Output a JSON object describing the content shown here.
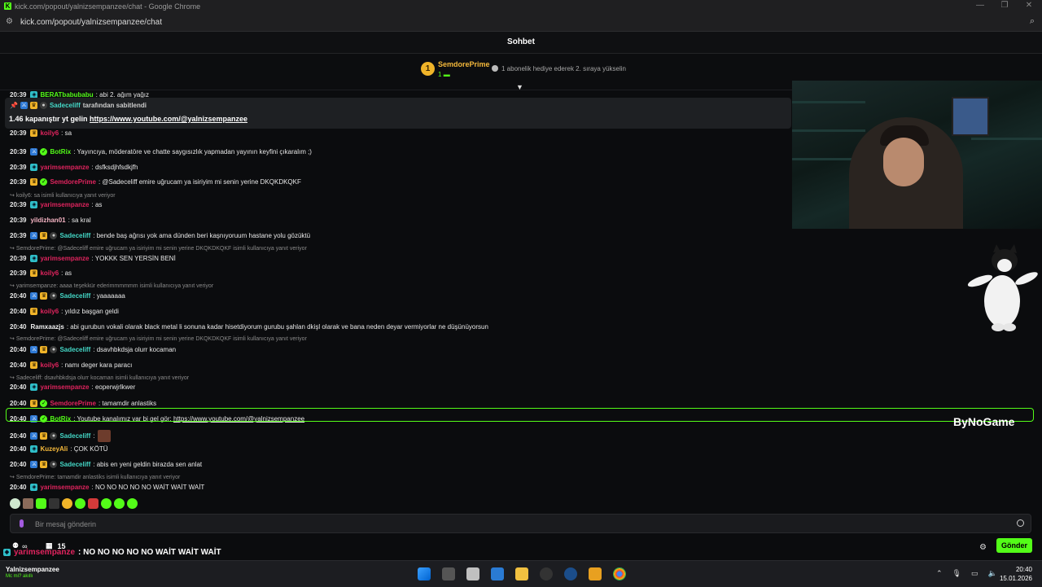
{
  "window": {
    "title": "kick.com/popout/yalnizsempanzee/chat - Google Chrome",
    "url": "kick.com/popout/yalnizsempanzee/chat"
  },
  "chat": {
    "header": "Sohbet",
    "leader": {
      "rank": "1",
      "name": "SemdorePrime",
      "count": "1",
      "hint": "1 abonelik hediye ederek 2. sıraya yükselin"
    },
    "pinned": {
      "by_user": "Sadeceliff",
      "by_suffix": "tarafından sabitlendi",
      "text_prefix": "1.46 kapanıştır yt gelin ",
      "link": "https://www.youtube.com/@yalnizsempanzee"
    },
    "clipped_top": [
      {
        "time": "20:39",
        "user": "BERATbabubabu",
        "text": ": abi 2. ağım yağız"
      },
      {
        "time": "20:39",
        "user": "koily6",
        "text": ": sa"
      }
    ],
    "messages": [
      {
        "time": "20:39",
        "user": "BotRix",
        "text": ": Yayıncıya, möderatöre ve chatte saygısızlık yapmadan yayının keyfini çıkaralım ;)"
      },
      {
        "time": "20:39",
        "user": "yarimsempanze",
        "text": ": dsfksdjhfsdkjfh"
      },
      {
        "time": "20:39",
        "user": "SemdorePrime",
        "text": ": @Sadeceliff emire uğrucam ya isiriyim mi senin yerine DKQKDKQKF"
      },
      {
        "reply": "koily6: sa isimli kullanıcıya yanıt veriyor"
      },
      {
        "time": "20:39",
        "user": "yarimsempanze",
        "text": ": as"
      },
      {
        "time": "20:39",
        "user": "yildizhan01",
        "text": ": sa kral"
      },
      {
        "time": "20:39",
        "user": "Sadeceliff",
        "text": ": bende baş ağrısı yok ama dünden beri kaşnıyoruum hastane yolu gözüktü"
      },
      {
        "reply": "SemdorePrime: @Sadeceliff emire uğrucam ya isiriyim mi senin yerine DKQKDKQKF isimli kullanıcıya yanıt veriyor"
      },
      {
        "time": "20:39",
        "user": "yarimsempanze",
        "text": ": YOKKK SEN YERSİN BENİ"
      },
      {
        "time": "20:39",
        "user": "koily6",
        "text": ": as"
      },
      {
        "reply": "yarimsempanze: aaaa teşekkür ederimmmmmm isimli kullanıcıya yanıt veriyor"
      },
      {
        "time": "20:40",
        "user": "Sadeceliff",
        "text": ": yaaaaaaa"
      },
      {
        "time": "20:40",
        "user": "koily6",
        "text": ": yıldız başgan geldi"
      },
      {
        "time": "20:40",
        "user": "Ramxaazjs",
        "text": ": abi gurubun vokali olarak black metal li sonuna kadar hisetdiyorum gurubu şahlan dkişl olarak ve bana neden deyar vermiyorlar ne düşünüyorsun"
      },
      {
        "reply": "SemdorePrime: @Sadeceliff emire uğrucam ya isiriyim mi senin yerine DKQKDKQKF isimli kullanıcıya yanıt veriyor"
      },
      {
        "time": "20:40",
        "user": "Sadeceliff",
        "text": ": dsavhbkdsja olurr kocaman"
      },
      {
        "time": "20:40",
        "user": "koily6",
        "text": ": namı deger kara paracı"
      },
      {
        "reply": "Sadeceliff: dsavhbkdsja olurr kocaman isimli kullanıcıya yanıt veriyor"
      },
      {
        "time": "20:40",
        "user": "yarimsempanze",
        "text": ": eoperwjrlkwer"
      },
      {
        "time": "20:40",
        "user": "SemdorePrime",
        "text": ": tamamdir anlastiks"
      },
      {
        "time": "20:40",
        "user": "BotRix",
        "text": ": Youtube kanalımız var bi gel gör: ",
        "link": "https://www.youtube.com/@yalnizsempanzee"
      },
      {
        "time": "20:40",
        "user": "Sadeceliff",
        "text": ":"
      },
      {
        "time": "20:40",
        "user": "KuzeyAli",
        "text": ": ÇOK KÖTÜ"
      },
      {
        "time": "20:40",
        "user": "Sadeceliff",
        "text": ": abis en yeni geldin birazda sen anlat"
      },
      {
        "reply": "SemdorePrime: tamamdir anlastiks isimli kullanıcıya yanıt veriyor"
      },
      {
        "time": "20:40",
        "user": "yarimsempanze",
        "text": ": NO NO NO NO NO WAİT WAİT WAİT"
      }
    ],
    "input_placeholder": "Bir mesaj gönderin",
    "footer": {
      "infinity": "∞",
      "count": "15",
      "send": "Gönder"
    }
  },
  "overlay": {
    "user": "yarimsempanze",
    "text": ": NO NO NO NO NO WAİT WAİT WAİT",
    "watermark": "ByNoGame"
  },
  "taskbar": {
    "account_name": "Yalnizsempanzee",
    "account_status": "Mc mi? akıllı",
    "time": "20:40",
    "date": "15.01.2026"
  },
  "colors": {
    "kick_green": "#53fc18",
    "gold": "#f0b429",
    "name_red": "#e0245e",
    "name_teal": "#44d7c6",
    "name_green": "#53fc18"
  }
}
